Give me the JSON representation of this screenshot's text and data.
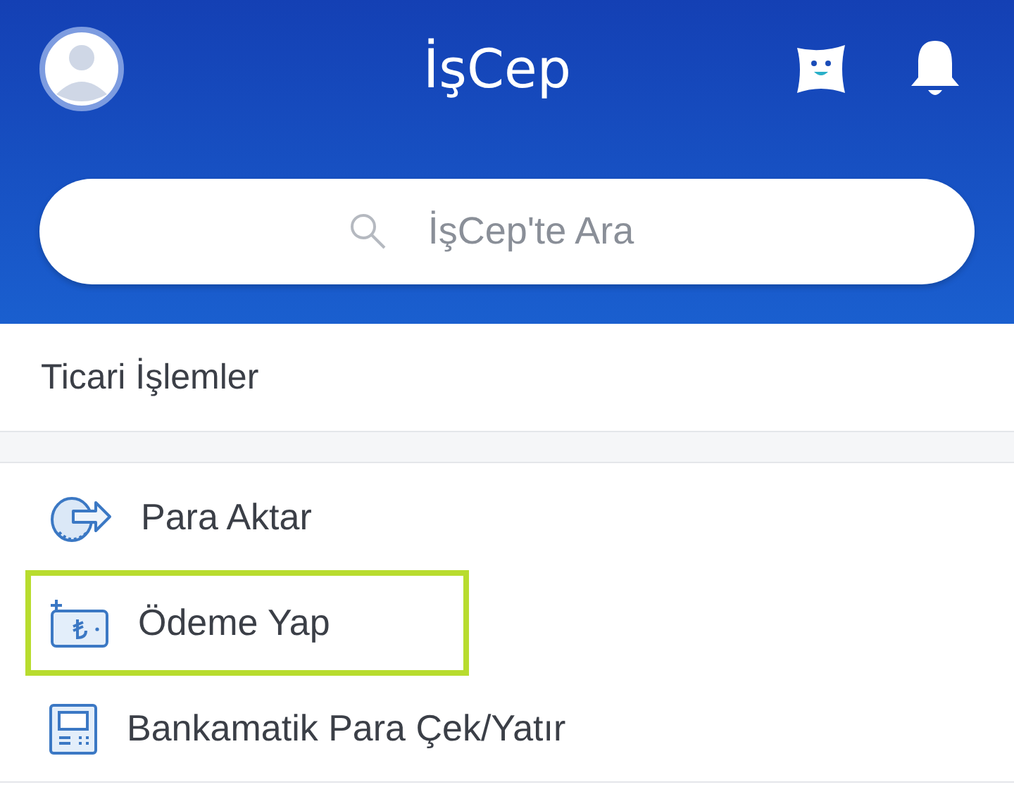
{
  "header": {
    "title": "İşCep"
  },
  "search": {
    "placeholder": "İşCep'te Ara"
  },
  "section": {
    "title": "Ticari İşlemler"
  },
  "items": [
    {
      "kind": "transfer",
      "label": "Para Aktar",
      "highlighted": false
    },
    {
      "kind": "payment",
      "label": "Ödeme Yap",
      "highlighted": true
    },
    {
      "kind": "atm",
      "label": "Bankamatik Para Çek/Yatır",
      "highlighted": false
    }
  ]
}
